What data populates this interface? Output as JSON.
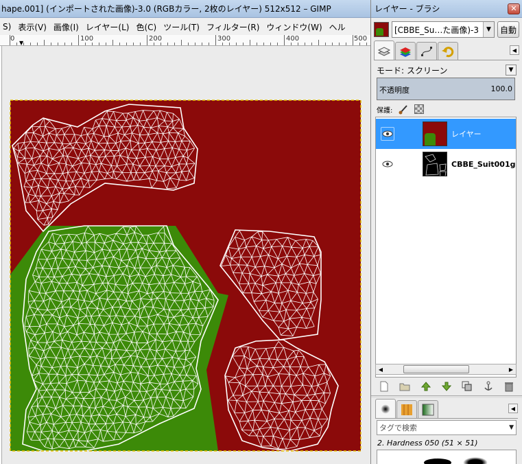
{
  "main_window": {
    "title": "hape.001] (インポートされた画像)-3.0 (RGBカラー, 2枚のレイヤー) 512x512 – GIMP",
    "menus": [
      "S)",
      "表示(V)",
      "画像(I)",
      "レイヤー(L)",
      "色(C)",
      "ツール(T)",
      "フィルター(R)",
      "ウィンドウ(W)",
      "ヘル"
    ],
    "ruler_labels": [
      "0",
      "100",
      "200",
      "300",
      "400",
      "500"
    ]
  },
  "dock": {
    "title": "レイヤー - ブラシ",
    "close_glyph": "✕",
    "image_selector": "[CBBE_Su…た画像)-3",
    "auto_button": "自動",
    "mode_label": "モード:",
    "mode_value": "スクリーン",
    "opacity_label": "不透明度",
    "opacity_value": "100.0",
    "protect_label": "保護:",
    "layers": [
      {
        "name": "レイヤー",
        "selected": true,
        "visible": true
      },
      {
        "name": "CBBE_Suit001g",
        "selected": false,
        "visible": true
      }
    ],
    "brush": {
      "tag_placeholder": "タグで検索",
      "selected_brush": "2. Hardness 050 (51 × 51)"
    }
  },
  "colors": {
    "canvas_background": "#8b0a0a",
    "green_region": "#3c8a08",
    "mesh_line": "#ffffff",
    "selection_blue": "#3399ff"
  },
  "icons": {
    "layers_tab": "layers-icon",
    "channels_tab": "channels-icon",
    "paths_tab": "paths-icon",
    "undo_tab": "undo-history-icon",
    "eye": "eye-icon",
    "paint_lock": "paintbrush-lock-icon",
    "alpha_lock": "alpha-lock-icon",
    "new_layer": "new-layer-icon",
    "layer_group": "folder-icon",
    "raise": "raise-arrow-icon",
    "lower": "lower-arrow-icon",
    "duplicate": "duplicate-icon",
    "anchor": "anchor-icon",
    "delete": "trash-icon"
  }
}
